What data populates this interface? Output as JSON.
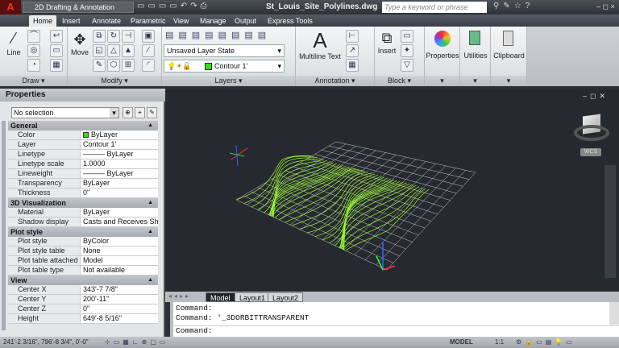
{
  "titlebar": {
    "app_menu": "A",
    "workspace": "2D Drafting & Annotation",
    "document": "St_Louis_Site_Polylines.dwg",
    "search_placeholder": "Type a keyword or phrase",
    "window_controls": "– ◻ ×"
  },
  "tabs": [
    {
      "label": "Home",
      "active": true
    },
    {
      "label": "Insert"
    },
    {
      "label": "Annotate"
    },
    {
      "label": "Parametric"
    },
    {
      "label": "View"
    },
    {
      "label": "Manage"
    },
    {
      "label": "Output"
    },
    {
      "label": "Express Tools"
    }
  ],
  "ribbon": {
    "draw": {
      "label": "Draw ▾",
      "line": "Line"
    },
    "modify": {
      "label": "Modify ▾",
      "move": "Move"
    },
    "layers": {
      "label": "Layers ▾",
      "layer_state": "Unsaved Layer State",
      "current_layer": "Contour 1'",
      "layer_color": "#33dd11"
    },
    "annotation": {
      "label": "Annotation ▾",
      "multiline_text": "Multiline Text"
    },
    "block": {
      "label": "Block ▾",
      "insert": "Insert"
    },
    "properties": {
      "label": "Properties"
    },
    "utilities": {
      "label": "Utilities"
    },
    "clipboard": {
      "label": "Clipboard"
    }
  },
  "properties": {
    "title": "Properties",
    "selection": "No selection",
    "sections": [
      {
        "title": "General",
        "rows": [
          [
            "Color",
            "ByLayer"
          ],
          [
            "Layer",
            "Contour 1'"
          ],
          [
            "Linetype",
            "——— ByLayer"
          ],
          [
            "Linetype scale",
            "1.0000"
          ],
          [
            "Lineweight",
            "——— ByLayer"
          ],
          [
            "Transparency",
            "ByLayer"
          ],
          [
            "Thickness",
            "0\""
          ]
        ]
      },
      {
        "title": "3D Visualization",
        "rows": [
          [
            "Material",
            "ByLayer"
          ],
          [
            "Shadow display",
            "Casts and Receives Sha..."
          ]
        ]
      },
      {
        "title": "Plot style",
        "rows": [
          [
            "Plot style",
            "ByColor"
          ],
          [
            "Plot style table",
            "None"
          ],
          [
            "Plot table attached to",
            "Model"
          ],
          [
            "Plot table type",
            "Not available"
          ]
        ]
      },
      {
        "title": "View",
        "rows": [
          [
            "Center X",
            "343'-7 7/8\""
          ],
          [
            "Center Y",
            "200'-11\""
          ],
          [
            "Center Z",
            "0\""
          ],
          [
            "Height",
            "649'-8 5/16\""
          ]
        ]
      }
    ]
  },
  "viewport": {
    "viewcube_wcs": "WCS",
    "wire_color": "#9aff2a",
    "grid_color": "#c8c8c8"
  },
  "layout_tabs": [
    "Model",
    "Layout1",
    "Layout2"
  ],
  "command_lines": [
    "Command:",
    "Command: '_3DORBITTRANSPARENT"
  ],
  "command_prompt": "Command:",
  "status": {
    "coords": "241'-2 3/16\", 796'-8 3/4\", 0'-0\"",
    "model": "MODEL",
    "scale": "1:1"
  }
}
